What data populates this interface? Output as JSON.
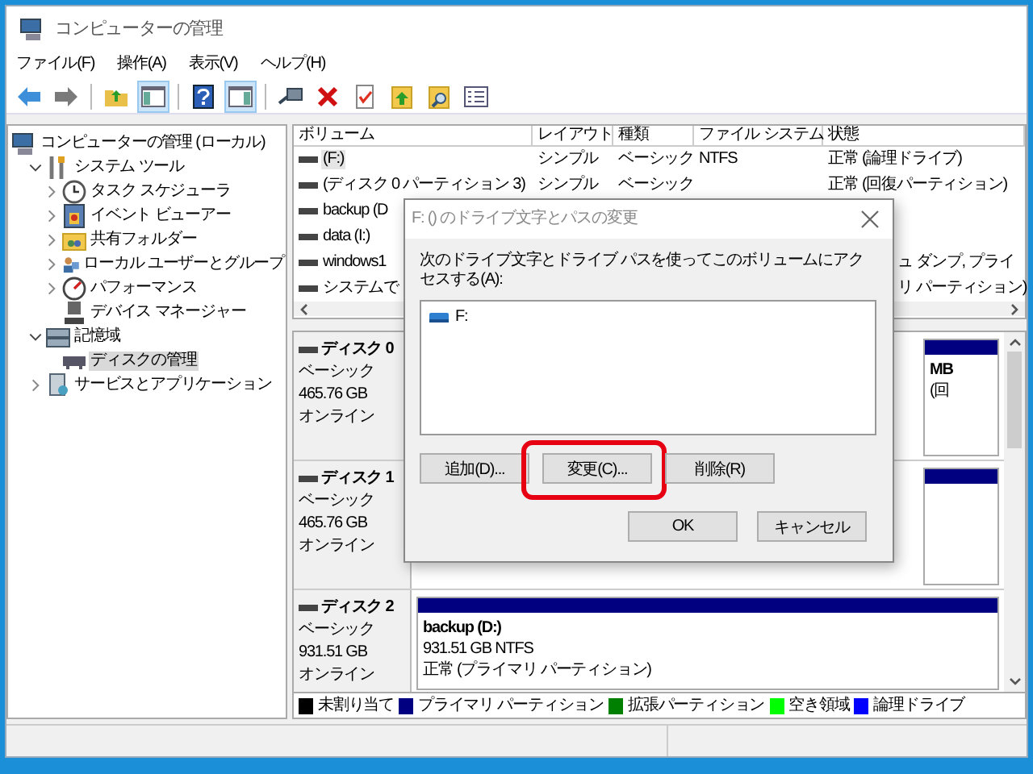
{
  "window": {
    "title": "コンピューターの管理"
  },
  "menu": [
    "ファイル(F)",
    "操作(A)",
    "表示(V)",
    "ヘルプ(H)"
  ],
  "toolbar": [
    {
      "kind": "back"
    },
    {
      "kind": "forward"
    },
    {
      "kind": "separator"
    },
    {
      "kind": "up"
    },
    {
      "kind": "tree",
      "pressed": true
    },
    {
      "kind": "separator"
    },
    {
      "kind": "help"
    },
    {
      "kind": "pane",
      "pressed": true
    },
    {
      "kind": "separator"
    },
    {
      "kind": "connect"
    },
    {
      "kind": "delete"
    },
    {
      "kind": "check"
    },
    {
      "kind": "folder-up"
    },
    {
      "kind": "folder-search"
    },
    {
      "kind": "list"
    }
  ],
  "tree": [
    {
      "label": "コンピューターの管理 (ローカル)",
      "kind": "computer",
      "selected": false,
      "children": [
        {
          "label": "システム ツール",
          "kind": "tools",
          "expanded": true,
          "selected": false,
          "children": [
            {
              "label": "タスク スケジューラ",
              "kind": "clock",
              "expanded": false,
              "selected": false
            },
            {
              "label": "イベント ビューアー",
              "kind": "event",
              "expanded": false,
              "selected": false
            },
            {
              "label": "共有フォルダー",
              "kind": "share",
              "expanded": false,
              "selected": false
            },
            {
              "label": "ローカル ユーザーとグループ",
              "kind": "users",
              "expanded": false,
              "selected": false
            },
            {
              "label": "パフォーマンス",
              "kind": "perf",
              "expanded": false,
              "selected": false
            },
            {
              "label": "デバイス マネージャー",
              "kind": "device",
              "selected": false
            }
          ]
        },
        {
          "label": "記憶域",
          "kind": "storage",
          "expanded": true,
          "selected": false,
          "children": [
            {
              "label": "ディスクの管理",
              "kind": "disk",
              "selected": true
            }
          ]
        },
        {
          "label": "サービスとアプリケーション",
          "kind": "services",
          "expanded": false,
          "selected": false
        }
      ]
    }
  ],
  "volumes": {
    "columns": [
      "ボリューム",
      "レイアウト",
      "種類",
      "ファイル システム",
      "状態"
    ],
    "rows": [
      {
        "kind": "full",
        "selected": true,
        "cells": [
          "(F:)",
          "シンプル",
          "ベーシック",
          "NTFS",
          "正常 (論理ドライブ)"
        ]
      },
      {
        "kind": "full",
        "selected": false,
        "cells": [
          "(ディスク 0 パーティション 3)",
          "シンプル",
          "ベーシック",
          "",
          "正常 (回復パーティション)"
        ]
      },
      {
        "kind": "covered",
        "selected": false,
        "cells": [
          "backup (D"
        ]
      },
      {
        "kind": "covered",
        "selected": false,
        "cells": [
          "data (I:)"
        ]
      },
      {
        "kind": "covered",
        "selected": false,
        "cells": [
          "windows1"
        ],
        "tail": "ュ ダンプ, プライ"
      },
      {
        "kind": "covered",
        "selected": false,
        "cells": [
          "システムで"
        ],
        "tail": "リ パーティション)"
      }
    ]
  },
  "disks": [
    {
      "name": "ディスク 0",
      "type": "ベーシック",
      "size": "465.76 GB",
      "status": "オンライン",
      "partitions": [
        {
          "kind": "partial",
          "color": "#000080",
          "lines": [
            "MB",
            "(回"
          ]
        }
      ]
    },
    {
      "name": "ディスク 1",
      "type": "ベーシック",
      "size": "465.76 GB",
      "status": "オンライン",
      "partitions": [
        {
          "kind": "partial",
          "color": "#000080"
        }
      ]
    },
    {
      "name": "ディスク 2",
      "type": "ベーシック",
      "size": "931.51 GB",
      "status": "オンライン",
      "partitions": [
        {
          "kind": "full",
          "color": "#000080",
          "lines": [
            "backup  (D:)",
            "931.51 GB NTFS",
            "正常 (プライマリ パーティション)"
          ]
        }
      ]
    }
  ],
  "legend": [
    {
      "label": "未割り当て",
      "color": "#000000"
    },
    {
      "label": "プライマリ パーティション",
      "color": "#000080"
    },
    {
      "label": "拡張パーティション",
      "color": "#008000"
    },
    {
      "label": "空き領域",
      "color": "#00ff00"
    },
    {
      "label": "論理ドライブ",
      "color": "#0000ff"
    }
  ],
  "dialog": {
    "title": "F: () のドライブ文字とパスの変更",
    "prompt": "次のドライブ文字とドライブ パスを使ってこのボリュームにアクセスする(A):",
    "paths": [
      {
        "label": "F:",
        "selected": false
      }
    ],
    "buttons": [
      {
        "label": "追加(D)...",
        "highlighted": false
      },
      {
        "label": "変更(C)...",
        "highlighted": true
      },
      {
        "label": "削除(R)",
        "highlighted": false
      }
    ],
    "actions": [
      "OK",
      "キャンセル"
    ]
  }
}
